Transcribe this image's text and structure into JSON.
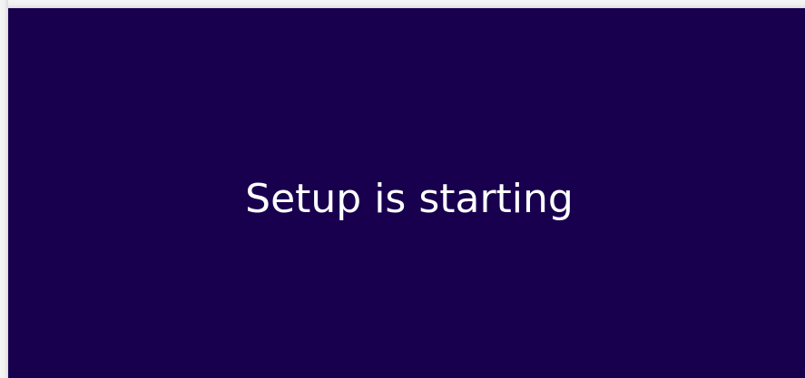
{
  "window": {
    "setup_message": "Setup is starting",
    "background_color": "#18004f",
    "text_color": "#ffffff"
  }
}
